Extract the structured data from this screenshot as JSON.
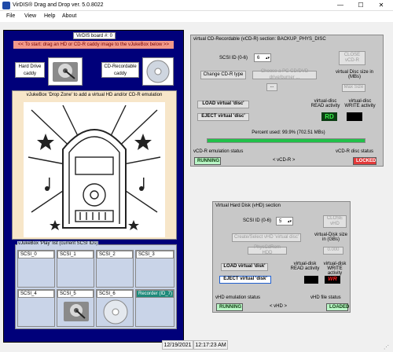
{
  "window": {
    "title": "VirDIS® Drag and Drop ver. 5.0.8022",
    "minimize": "—",
    "maximize": "☐",
    "close": "✕"
  },
  "menu": [
    "File",
    "View",
    "Help",
    "About"
  ],
  "left": {
    "board_label": "VirDIS board #: 0",
    "instruction": "<< To start: drag an HD or CD-R caddy image to the vJukeBox below >>",
    "hd_caddy_label": "Hard Drive caddy",
    "cdr_caddy_label": "CD-Recordable caddy",
    "dropzone_label": "vJukeBox 'Drop Zone' to add a virtual HD and/or CD-R emulation",
    "playlist_label": "vJukeBox 'Play' list (current SCSI IDs)",
    "slots": [
      "SCSI_0",
      "SCSI_1",
      "SCSI_2",
      "SCSI_3",
      "SCSI_4",
      "SCSI_5",
      "SCSI_6",
      "Recorder (ID_7)"
    ]
  },
  "cdr": {
    "section_title": "virtual CD-Recordable (vCD-R) section: BACKUP_PHYS_DISC",
    "scsi_id_label": "SCSI ID (0-6)",
    "scsi_id_value": "6",
    "close_btn": "CLOSE vCD-R",
    "change_type_btn": "Change CD-R type",
    "choose_burner_btn": "Choose a PC CD/DVD drive/burner ...",
    "size_label": "virtual Disc size in (MBs)",
    "size_value": "Max Size",
    "small_btn": "...",
    "load_btn": "LOAD virtual 'disc'",
    "eject_btn": "EJECT virtual 'disc'",
    "read_label": "virtual-disc READ activity",
    "write_label": "virtual-disc WRITE activity",
    "read_indicator": "RD",
    "percent_used": "Percent used: 99.9% (702.51 MBs)",
    "percent_value": 0.999,
    "emu_status_label": "vCD-R emulation status",
    "disc_status_label": "vCD-R disc status",
    "emu_status": "RUNNING",
    "device_label": "< vCD-R >",
    "disc_status": "LOCKED"
  },
  "vhd": {
    "section_title": "Virtual Hard Disk (vHD) section",
    "scsi_id_label": "SCSI ID (0-6)",
    "scsi_id_value": "5",
    "close_btn": "CLOSE vHD",
    "create_btn": "Create/Select vHD 'virtual disc'",
    "size_label": "virtual-Disk size in (GBs)",
    "size_value": "0.000",
    "physical_btn": "PhysCdRom HDD",
    "load_btn": "LOAD virtual 'disk'",
    "eject_btn": "EJECT virtual 'disk'",
    "read_label": "virtual-disk READ activity",
    "write_label": "virtual-disk WRITE activity",
    "write_indicator": "WR",
    "emu_status_label": "vHD emulation status",
    "file_status_label": "vHD file status",
    "emu_status": "RUNNING",
    "device_label": "< vHD >",
    "file_status": "LOADED"
  },
  "statusbar": {
    "date": "12/19/2021",
    "time": "12:17:23 AM"
  },
  "colors": {
    "blue_panel": "#00007a",
    "instruction_bg": "#f29a8a",
    "status_green": "#b9f5c6",
    "status_red": "#e23a3a",
    "progress_green": "#21c04a"
  }
}
